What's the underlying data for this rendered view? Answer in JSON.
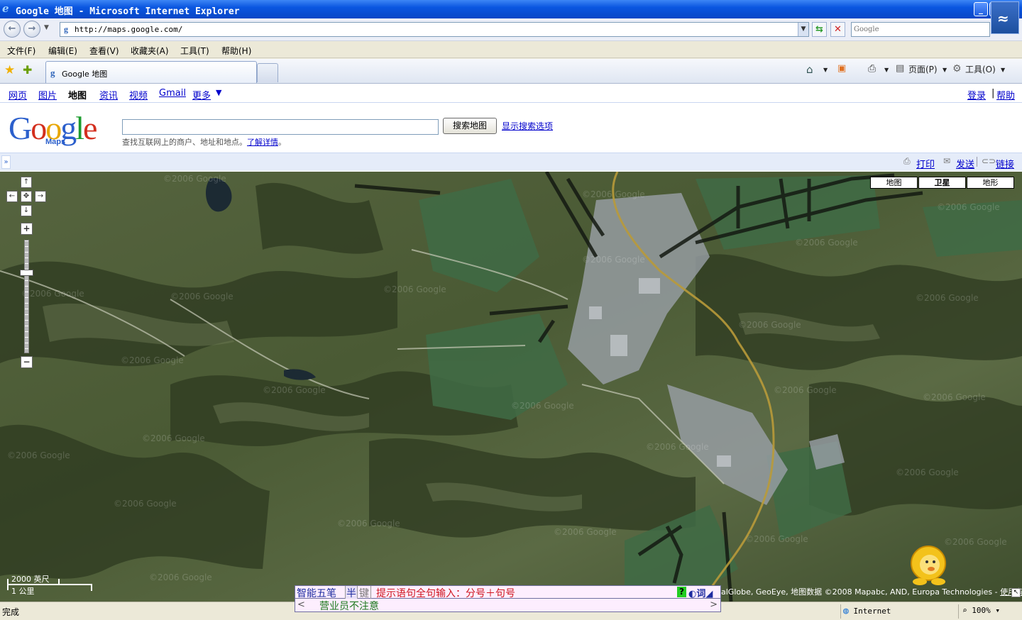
{
  "window": {
    "title": "Google 地图 - Microsoft Internet Explorer",
    "min_symbol": "_",
    "max_symbol": "▫"
  },
  "address_bar": {
    "url": "http://maps.google.com/",
    "search_placeholder": "Google"
  },
  "menu": [
    "文件(F)",
    "编辑(E)",
    "查看(V)",
    "收藏夹(A)",
    "工具(T)",
    "帮助(H)"
  ],
  "tab": {
    "label": "Google 地图"
  },
  "command_bar": {
    "page": "页面(P)",
    "tools": "工具(O)"
  },
  "google_nav": {
    "items": [
      "网页",
      "图片",
      "地图",
      "资讯",
      "视频",
      "Gmail",
      "更多"
    ],
    "signin": "登录",
    "help": "帮助"
  },
  "maps_search": {
    "logo_sub": "Maps",
    "button": "搜索地图",
    "show_options": "显示搜索选项",
    "hint": "查找互联网上的商户、地址和地点。",
    "learn_more": "了解详情"
  },
  "actions": {
    "print": "打印",
    "send": "发送",
    "link": "链接"
  },
  "map": {
    "types": [
      "地图",
      "卫星",
      "地形"
    ],
    "selected_type": "卫星",
    "scale_imperial": "2000 英尺",
    "scale_metric": "1 公里",
    "copyright": "alGlobe, GeoEye, 地图数据 ©2008 Mapabc, AND, Europa Technologies - ",
    "terms": "使用条款",
    "zoom_level_fraction": 0.28
  },
  "ime": {
    "name": "智能五笔",
    "half": "半",
    "jian": "键",
    "hint": "提示语句全句输入：分号＋句号",
    "candidate": "营业员不注意"
  },
  "status_bar": {
    "text": "完成",
    "zone": "Internet",
    "zoom": "100%"
  },
  "colors": {
    "title_bar": "#0a56e0",
    "link": "#0000cc",
    "action_bar": "#e5ecf9",
    "ime_hint": "#d0151f"
  }
}
